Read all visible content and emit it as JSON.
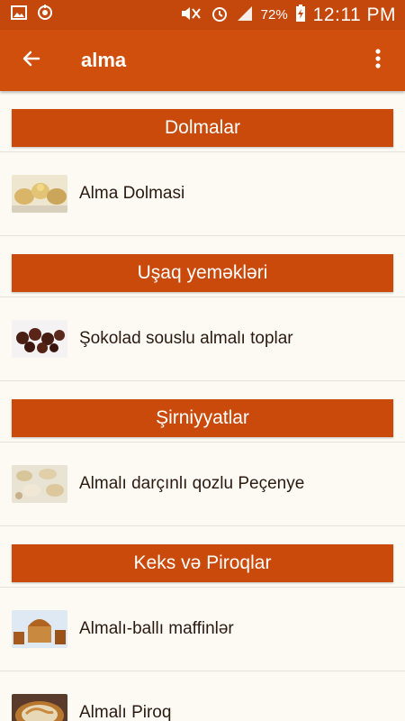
{
  "status_bar": {
    "battery": "72%",
    "time": "12:11 PM",
    "icons": [
      "image-icon",
      "sync-icon",
      "mute-icon",
      "alarm-icon",
      "signal-icon",
      "battery-charging-icon"
    ]
  },
  "app_bar": {
    "title": "alma",
    "back_icon": "back-arrow-icon",
    "menu_icon": "more-vert-icon"
  },
  "sections": [
    {
      "title": "Dolmalar",
      "items": [
        {
          "name": "Alma Dolmasi"
        }
      ]
    },
    {
      "title": "Uşaq yeməkləri",
      "items": [
        {
          "name": "Şokolad souslu almalı toplar"
        }
      ]
    },
    {
      "title": "Şirniyyatlar",
      "items": [
        {
          "name": "Almalı darçınlı qozlu Peçenye"
        }
      ]
    },
    {
      "title": "Keks və Piroqlar",
      "items": [
        {
          "name": "Almalı-ballı maffinlər"
        },
        {
          "name": "Almalı Piroq"
        }
      ]
    }
  ],
  "colors": {
    "status_bar": "#c4470b",
    "app_bar": "#d14f0c",
    "section_header": "#c94a0b",
    "background": "#fdfaf4"
  }
}
